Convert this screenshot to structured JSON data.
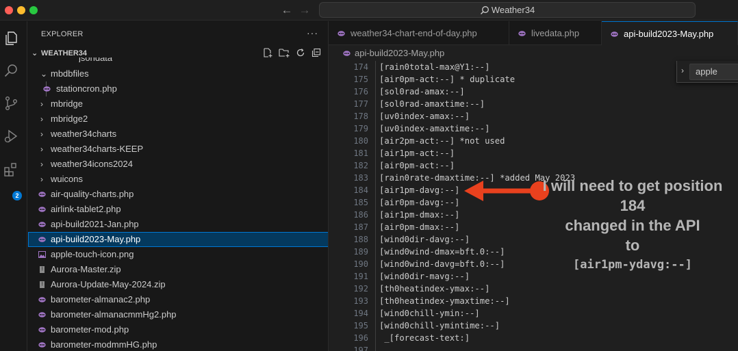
{
  "titlebar": {
    "search_text": "Weather34"
  },
  "explorer": {
    "title": "EXPLORER",
    "more": "···",
    "folder_name": "WEATHER34",
    "partial_item": "jsondata",
    "items": [
      {
        "label": "mbdbfiles",
        "type": "folder"
      },
      {
        "label": "stationcron.php",
        "type": "php"
      },
      {
        "label": "mbridge",
        "type": "folder"
      },
      {
        "label": "mbridge2",
        "type": "folder"
      },
      {
        "label": "weather34charts",
        "type": "folder"
      },
      {
        "label": "weather34charts-KEEP",
        "type": "folder"
      },
      {
        "label": "weather34icons2024",
        "type": "folder"
      },
      {
        "label": "wuicons",
        "type": "folder"
      },
      {
        "label": "air-quality-charts.php",
        "type": "php"
      },
      {
        "label": "airlink-tablet2.php",
        "type": "php"
      },
      {
        "label": "api-build2021-Jan.php",
        "type": "php"
      },
      {
        "label": "api-build2023-May.php",
        "type": "php"
      },
      {
        "label": "apple-touch-icon.png",
        "type": "image"
      },
      {
        "label": "Aurora-Master.zip",
        "type": "zip"
      },
      {
        "label": "Aurora-Update-May-2024.zip",
        "type": "zip"
      },
      {
        "label": "barometer-almanac2.php",
        "type": "php"
      },
      {
        "label": "barometer-almanacmmHg2.php",
        "type": "php"
      },
      {
        "label": "barometer-mod.php",
        "type": "php"
      },
      {
        "label": "barometer-modmmHG.php",
        "type": "php"
      }
    ]
  },
  "activity": {
    "extensions_badge": "2"
  },
  "editor": {
    "tabs": [
      {
        "label": "weather34-chart-end-of-day.php"
      },
      {
        "label": "livedata.php"
      },
      {
        "label": "api-build2023-May.php"
      }
    ],
    "breadcrumb": "api-build2023-May.php",
    "find_value": "apple",
    "lines": [
      {
        "num": "174",
        "text": "[rain0total-max@Y1:--]"
      },
      {
        "num": "175",
        "text": "[air0pm-act:--] * duplicate"
      },
      {
        "num": "176",
        "text": "[sol0rad-amax:--]"
      },
      {
        "num": "177",
        "text": "[sol0rad-amaxtime:--]"
      },
      {
        "num": "178",
        "text": "[uv0index-amax:--]"
      },
      {
        "num": "179",
        "text": "[uv0index-amaxtime:--]"
      },
      {
        "num": "180",
        "text": "[air2pm-act:--] *not used"
      },
      {
        "num": "181",
        "text": "[air1pm-act:--]"
      },
      {
        "num": "182",
        "text": "[air0pm-act:--]"
      },
      {
        "num": "183",
        "text": "[rain0rate-dmaxtime:--] *added May 2023"
      },
      {
        "num": "184",
        "text": "[air1pm-davg:--]"
      },
      {
        "num": "185",
        "text": "[air0pm-davg:--]"
      },
      {
        "num": "186",
        "text": "[air1pm-dmax:--]"
      },
      {
        "num": "187",
        "text": "[air0pm-dmax:--]"
      },
      {
        "num": "188",
        "text": "[wind0dir-davg:--]"
      },
      {
        "num": "189",
        "text": "[wind0wind-dmax=bft.0:--]"
      },
      {
        "num": "190",
        "text": "[wind0wind-davg=bft.0:--]"
      },
      {
        "num": "191",
        "text": "[wind0dir-mavg:--]"
      },
      {
        "num": "192",
        "text": "[th0heatindex-ymax:--]"
      },
      {
        "num": "193",
        "text": "[th0heatindex-ymaxtime:--]"
      },
      {
        "num": "194",
        "text": "[wind0chill-ymin:--]"
      },
      {
        "num": "195",
        "text": "[wind0chill-ymintime:--]"
      },
      {
        "num": "196",
        "text": " _[forecast-text:]"
      },
      {
        "num": "197",
        "text": ""
      }
    ]
  },
  "annotation": {
    "line1": "I will need to get position",
    "line2": "184",
    "line3": "changed in the API",
    "line4": "to",
    "line5": "[air1pm-ydavg:--]",
    "arrow_color": "#e8411e"
  },
  "colors": {
    "accent": "#0078d4",
    "php_icon": "#a074c4",
    "selection": "#04395e"
  }
}
